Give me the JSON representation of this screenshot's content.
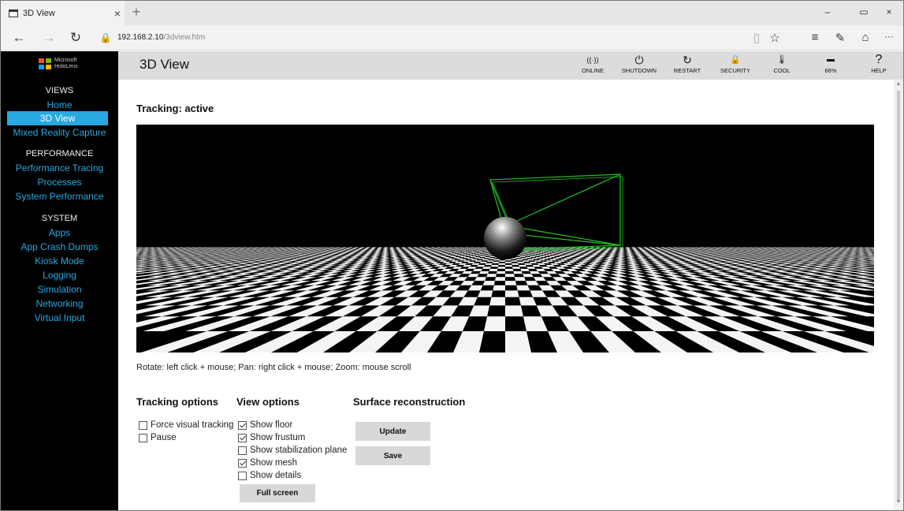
{
  "browser": {
    "tab_title": "3D View",
    "tab_close": "×",
    "new_tab": "+",
    "minimize": "–",
    "restore": "▭",
    "close": "×",
    "back": "←",
    "forward": "→",
    "refresh": "↻",
    "lock": "🔒",
    "url_host": "192.168.2.10",
    "url_path": "/3dview.htm",
    "reading_view": "▯",
    "favorite": "☆",
    "hub": "≡",
    "note": "✎",
    "share": "⌂",
    "more": "···"
  },
  "sidebar": {
    "logo_line1": "Microsoft",
    "logo_line2": "HoloLens",
    "logo_colors": [
      "#f25022",
      "#7fba00",
      "#00a4ef",
      "#ffb900"
    ],
    "sections": [
      {
        "heading": "VIEWS",
        "items": [
          "Home",
          "3D View",
          "Mixed Reality Capture"
        ]
      },
      {
        "heading": "PERFORMANCE",
        "items": [
          "Performance Tracing",
          "Processes",
          "System Performance"
        ]
      },
      {
        "heading": "SYSTEM",
        "items": [
          "Apps",
          "App Crash Dumps",
          "Kiosk Mode",
          "Logging",
          "Simulation",
          "Networking",
          "Virtual Input"
        ]
      }
    ],
    "active_item": "3D View",
    "accent_color": "#27a9e1"
  },
  "header": {
    "title": "3D View",
    "buttons": [
      {
        "label": "ONLINE",
        "icon": "wifi-icon",
        "glyph": "((·))"
      },
      {
        "label": "SHUTDOWN",
        "icon": "power-icon",
        "glyph": "⏻"
      },
      {
        "label": "RESTART",
        "icon": "restart-icon",
        "glyph": "↻"
      },
      {
        "label": "SECURITY",
        "icon": "lock-icon",
        "glyph": "🔒"
      },
      {
        "label": "COOL",
        "icon": "thermometer-icon",
        "glyph": "🌡"
      },
      {
        "label": "66%",
        "icon": "battery-icon",
        "glyph": "▬"
      },
      {
        "label": "HELP",
        "icon": "help-icon",
        "glyph": "?"
      }
    ]
  },
  "content": {
    "tracking_status": "Tracking: active",
    "controls_hint": "Rotate: left click + mouse; Pan: right click + mouse; Zoom: mouse scroll",
    "tracking_options": {
      "title": "Tracking options",
      "items": [
        {
          "label": "Force visual tracking",
          "checked": false
        },
        {
          "label": "Pause",
          "checked": false
        }
      ]
    },
    "view_options": {
      "title": "View options",
      "items": [
        {
          "label": "Show floor",
          "checked": true
        },
        {
          "label": "Show frustum",
          "checked": true
        },
        {
          "label": "Show stabilization plane",
          "checked": false
        },
        {
          "label": "Show mesh",
          "checked": true
        },
        {
          "label": "Show details",
          "checked": false
        }
      ],
      "full_screen_label": "Full screen"
    },
    "surface_reconstruction": {
      "title": "Surface reconstruction",
      "update_label": "Update",
      "save_label": "Save"
    }
  }
}
